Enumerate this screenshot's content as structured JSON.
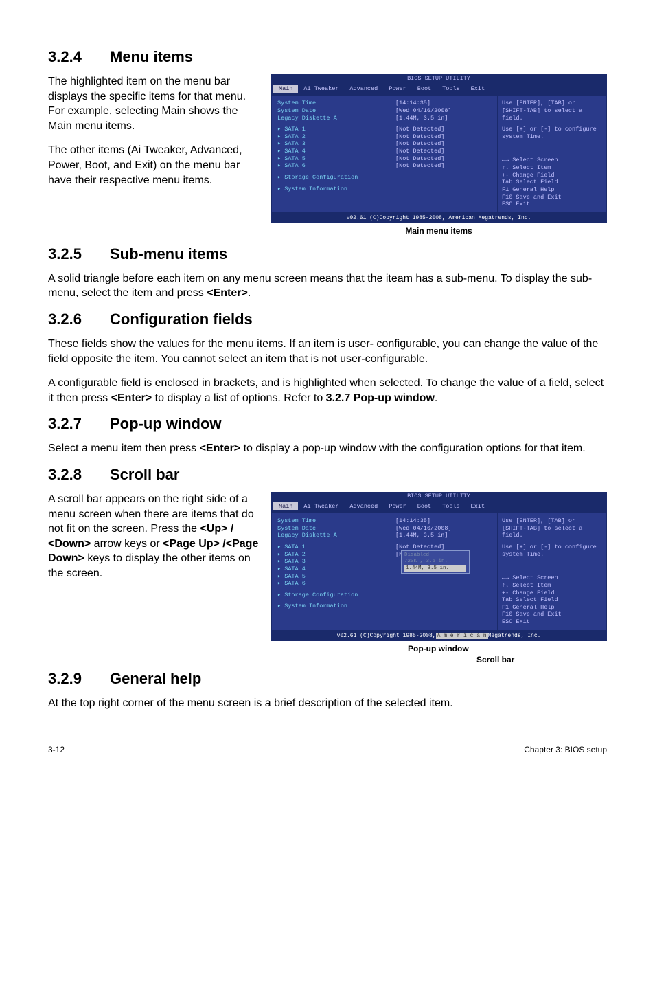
{
  "s324": {
    "heading_num": "3.2.4",
    "heading_txt": "Menu items",
    "p1": "The highlighted item on the menu bar displays the specific items for that menu. For example, selecting Main shows the Main menu items.",
    "p2": "The other items (Ai Tweaker, Advanced, Power, Boot, and Exit) on the menu bar have their respective menu items.",
    "caption": "Main menu items"
  },
  "s325": {
    "heading_num": "3.2.5",
    "heading_txt": "Sub-menu items",
    "p1a": "A solid triangle before each item on any menu screen means that the iteam has a sub-menu. To display the sub-menu, select the item and press ",
    "p1b": "<Enter>",
    "p1c": "."
  },
  "s326": {
    "heading_num": "3.2.6",
    "heading_txt": "Configuration fields",
    "p1": "These fields show the values for the menu items. If an item is user- configurable, you can change the value of the field opposite the item. You cannot select an item that is not user-configurable.",
    "p2a": "A configurable field is enclosed in brackets, and is highlighted when selected. To change the value of a field, select it then press ",
    "p2b": "<Enter>",
    "p2c": " to display a list of options. Refer to ",
    "p2d": "3.2.7 Pop-up window",
    "p2e": "."
  },
  "s327": {
    "heading_num": "3.2.7",
    "heading_txt": "Pop-up window",
    "p1a": "Select a menu item then press ",
    "p1b": "<Enter>",
    "p1c": " to display a pop-up window with the configuration options for that item."
  },
  "s328": {
    "heading_num": "3.2.8",
    "heading_txt": "Scroll bar",
    "p1a": "A scroll bar appears on the right side of a menu screen when there are items that do not fit on the screen. Press the ",
    "p1b": "<Up> / <Down>",
    "p1c": " arrow keys or ",
    "p1d": "<Page Up> /<Page Down>",
    "p1e": " keys to display the other items on the screen.",
    "caption1": "Pop-up window",
    "caption2": "Scroll bar"
  },
  "s329": {
    "heading_num": "3.2.9",
    "heading_txt": "General help",
    "p1": "At the top right corner of the menu screen is a brief description of the selected item."
  },
  "bios": {
    "title": "BIOS SETUP UTILITY",
    "tabs": [
      "Main",
      "Ai Tweaker",
      "Advanced",
      "Power",
      "Boot",
      "Tools",
      "Exit"
    ],
    "rows": [
      {
        "lbl": "System Time",
        "val": "[14:14:35]"
      },
      {
        "lbl": "System Date",
        "val": "[Wed 04/16/2008]"
      },
      {
        "lbl": "Legacy Diskette A",
        "val": "[1.44M, 3.5 in]"
      }
    ],
    "sata": [
      {
        "lbl": "▸ SATA 1",
        "val": "[Not Detected]"
      },
      {
        "lbl": "▸ SATA 2",
        "val": "[Not Detected]"
      },
      {
        "lbl": "▸ SATA 3",
        "val": "[Not Detected]"
      },
      {
        "lbl": "▸ SATA 4",
        "val": "[Not Detected]"
      },
      {
        "lbl": "▸ SATA 5",
        "val": "[Not Detected]"
      },
      {
        "lbl": "▸ SATA 6",
        "val": "[Not Detected]"
      }
    ],
    "subs": [
      "▸ Storage Configuration",
      "▸ System Information"
    ],
    "help1": "Use [ENTER], [TAB] or [SHIFT-TAB] to select a field.",
    "help2": "Use [+] or [-] to configure system Time.",
    "keys": [
      "←→  Select Screen",
      "↑↓  Select Item",
      "+-  Change Field",
      "Tab Select Field",
      "F1  General Help",
      "F10 Save and Exit",
      "ESC Exit"
    ],
    "footer": "v02.61 (C)Copyright 1985-2008, American Megatrends, Inc.",
    "footer2_a": "v02.61 (C)Copyright 1985-2008,",
    "footer2_b": "A  m  e  r  i  c  a  n",
    "footer2_c": "Megatrends, Inc.",
    "popup": {
      "opt1": "Disabled",
      "opt2": "720K , 3.5 in.",
      "opt3": "1.44M, 3.5 in."
    }
  },
  "footer": {
    "left": "3-12",
    "right": "Chapter 3: BIOS setup"
  }
}
